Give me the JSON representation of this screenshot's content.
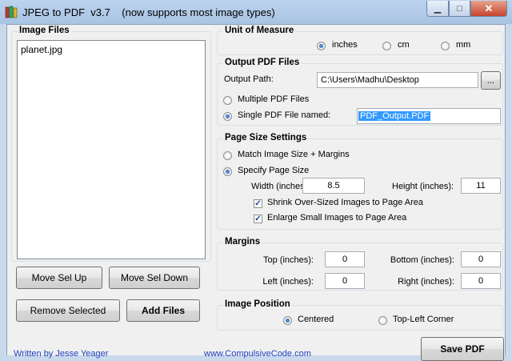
{
  "window": {
    "title": "JPEG to PDF  v3.7    (now supports most image types)"
  },
  "image_files": {
    "title": "Image Files",
    "items": [
      "planet.jpg"
    ],
    "move_up_label": "Move Sel Up",
    "move_down_label": "Move Sel Down",
    "remove_label": "Remove Selected",
    "add_label": "Add Files"
  },
  "unit_of_measure": {
    "title": "Unit of Measure",
    "options": [
      "inches",
      "cm",
      "mm"
    ],
    "selected": "inches"
  },
  "output_pdf": {
    "title": "Output PDF Files",
    "path_label": "Output Path:",
    "path_value": "C:\\Users\\Madhu\\Desktop",
    "browse_label": "...",
    "multiple_label": "Multiple PDF Files",
    "single_label": "Single PDF File named:",
    "single_value": "PDF_Output.PDF",
    "selected": "single"
  },
  "page_size": {
    "title": "Page Size Settings",
    "match_label": "Match Image Size + Margins",
    "specify_label": "Specify Page Size",
    "selected": "specify",
    "width_label": "Width (inches):",
    "width_value": "8.5",
    "height_label": "Height (inches):",
    "height_value": "11",
    "shrink_label": "Shrink Over-Sized Images to Page Area",
    "shrink_checked": true,
    "enlarge_label": "Enlarge Small Images to Page Area",
    "enlarge_checked": true
  },
  "margins": {
    "title": "Margins",
    "top_label": "Top (inches):",
    "top_value": "0",
    "bottom_label": "Bottom (inches):",
    "bottom_value": "0",
    "left_label": "Left (inches):",
    "left_value": "0",
    "right_label": "Right (inches):",
    "right_value": "0"
  },
  "image_position": {
    "title": "Image Position",
    "centered_label": "Centered",
    "topleft_label": "Top-Left Corner",
    "selected": "centered"
  },
  "footer": {
    "author": "Written by Jesse Yeager",
    "website": "www.CompulsiveCode.com",
    "save_label": "Save PDF"
  },
  "colors": {
    "selection": "#3399ff",
    "title_bar": "#bcd3ee",
    "close_button": "#c6452b",
    "link": "#1f3fbf"
  }
}
